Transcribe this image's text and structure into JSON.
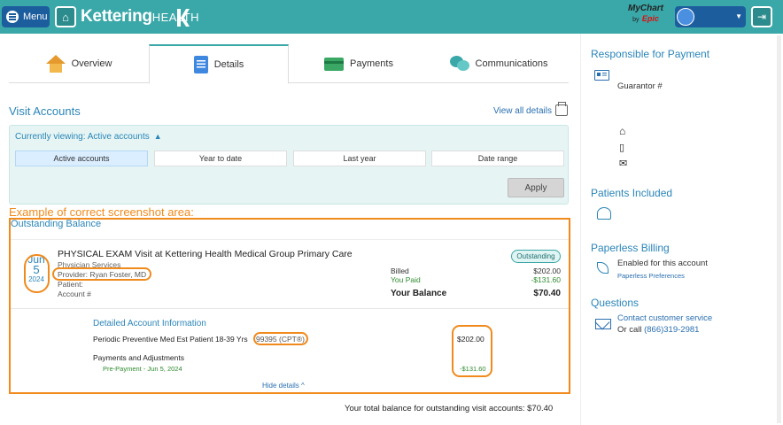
{
  "header": {
    "menu_label": "Menu",
    "brand_main": "Kettering",
    "brand_small": "HEALTH",
    "mychart_top": "MyChart",
    "mychart_by": "by",
    "mychart_epic": "Epic"
  },
  "tabs": [
    {
      "label": "Overview",
      "icon": "house-icon",
      "active": false
    },
    {
      "label": "Details",
      "icon": "document-icon",
      "active": true
    },
    {
      "label": "Payments",
      "icon": "credit-card-icon",
      "active": false
    },
    {
      "label": "Communications",
      "icon": "chat-icon",
      "active": false
    }
  ],
  "visit_accounts": {
    "title": "Visit Accounts",
    "view_all": "View all details",
    "currently_viewing": "Currently viewing: Active accounts",
    "filters": [
      "Active accounts",
      "Year to date",
      "Last year",
      "Date range"
    ],
    "apply": "Apply"
  },
  "annotation": {
    "label": "Example of correct screenshot area:",
    "color": "#f08a1c"
  },
  "outstanding": {
    "title": "Outstanding Balance",
    "visit": {
      "month": "Jun",
      "day": "5",
      "year": "2024",
      "title": "PHYSICAL EXAM Visit at Kettering Health Medical Group Primary Care",
      "department": "Physician Services",
      "provider": "Provider: Ryan Foster, MD",
      "patient": "Patient:",
      "account": "Account #",
      "status": "Outstanding",
      "billed_label": "Billed",
      "billed": "$202.00",
      "paid_label": "You Paid",
      "paid": "-$131.60",
      "balance_label": "Your Balance",
      "balance": "$70.40"
    },
    "detail": {
      "title": "Detailed Account Information",
      "procedure": "Periodic Preventive Med Est Patient 18-39 Yrs",
      "cpt": "99395 (CPT®)",
      "procedure_amount": "$202.00",
      "payments_label": "Payments and Adjustments",
      "prepayment": "Pre-Payment - Jun 5, 2024",
      "prepayment_amount": "-$131.60",
      "hide": "Hide details"
    },
    "total": "Your total balance for outstanding visit accounts: $70.40"
  },
  "side": {
    "responsible_title": "Responsible for Payment",
    "guarantor": "Guarantor #",
    "patients_title": "Patients Included",
    "paperless_title": "Paperless Billing",
    "paperless_status": "Enabled for this account",
    "paperless_link": "Paperless Preferences",
    "questions_title": "Questions",
    "contact_link": "Contact customer service",
    "or_call": "Or call",
    "phone": "(866)319-2981"
  }
}
